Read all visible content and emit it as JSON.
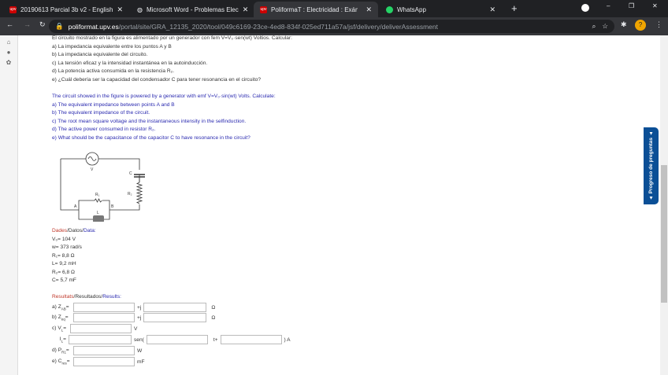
{
  "tabs": [
    {
      "label": "20190613 Parcial 3b v2 - English",
      "icon": "upv-icon"
    },
    {
      "label": "Microsoft Word - Problemas Elec",
      "icon": "globe-icon"
    },
    {
      "label": "PoliformaT : Electricidad : Exámen",
      "icon": "upv-icon"
    },
    {
      "label": "WhatsApp",
      "icon": "whatsapp-icon"
    }
  ],
  "url": {
    "host": "poliformat.upv.es",
    "path": "/portal/site/GRA_12135_2020/tool/049c6169-23ce-4ed8-834f-025ed711a57a/jsf/delivery/deliverAssessment"
  },
  "question_es": [
    "El circuito mostrado en la figura es alimentado por un generador con fem V=V₀·sen(wt) Voltios. Calcular:",
    "a) La impedancia equivalente entre los puntos A y B",
    "b) La impedancia equivalente del circuito.",
    "c) La tensión eficaz y la intensidad instantánea en la autoinducción.",
    "d) La potencia activa consumida en la resistencia R₂.",
    "e) ¿Cuál debería ser la capacidad del condensador C para tener resonancia en el circuito?"
  ],
  "question_en": [
    "The circuit showed in the figure is powered by a generator with emf V=V₀·sin(wt) Volts. Calculate:",
    "a) The equivalent impedance between points A and B",
    "b) The equivalent impedance of the circuit.",
    "c) The root mean square voltage and the instantaneous intensity in the selfinduction.",
    "d) The active power consumed in resistor R₂.",
    "e) What should be the capacitance of the capacitor C to have resonance in the circuit?"
  ],
  "circuit": {
    "V": "V",
    "C": "C",
    "R1": "R₁",
    "R2": "R₂",
    "L": "L",
    "A": "A",
    "B": "B"
  },
  "data_header": {
    "ca": "Dades",
    "sep1": "/",
    "es": "Datos",
    "sep2": "/",
    "en": "Data:"
  },
  "data": [
    "V₀= 104 V",
    "w= 373 rad/s",
    "R₁= 8,8 Ω",
    "L= 9,2 mH",
    "R₂= 6,8 Ω",
    "C= 5,7 mF"
  ],
  "results_header": {
    "ca": "Resultats",
    "sep1": "/",
    "es": "Resultados",
    "sep2": "/",
    "en": "Results:"
  },
  "results": {
    "zab": "a) Z",
    "zab_sub": "AB",
    "zeq": "b) Z",
    "zeq_sub": "eq",
    "vl": "c) V",
    "vl_sub": "L",
    "il": "I",
    "il_sub": "L",
    "pr": "d) P",
    "pr_sub": "R1",
    "cres": "e) C",
    "cres_sub": "res",
    "eq": "=",
    "j": "+j",
    "ohm": "Ω",
    "volt": "V",
    "sen": "sen(",
    "tplus": "t+",
    "amp": ") A",
    "watt": "W",
    "mf": "mF"
  },
  "progress_label": "▲ Progreso de preguntas ▲",
  "colors": {
    "ca": "#c0392b",
    "en": "#2b2bb0",
    "accent": "#0b4f96"
  }
}
